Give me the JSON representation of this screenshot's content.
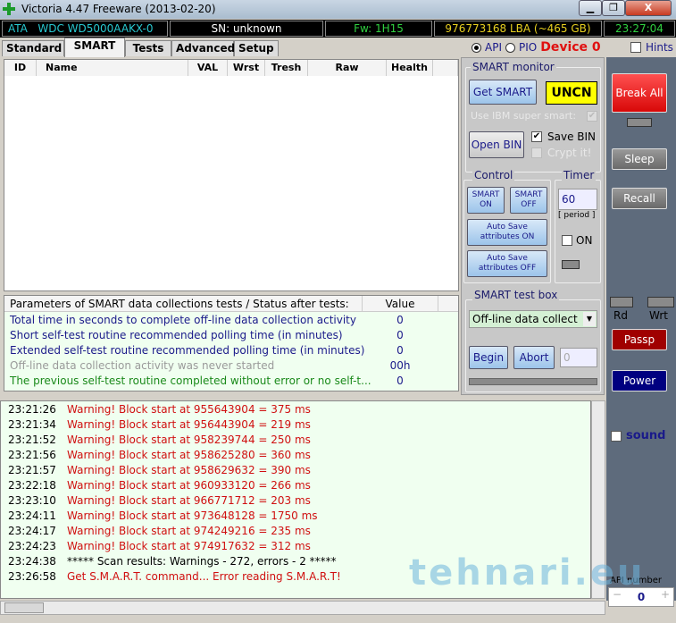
{
  "window": {
    "title": "Victoria 4.47  Freeware (2013-02-20)",
    "minimize": "▁",
    "maximize": "❐",
    "close": "X"
  },
  "infobar": {
    "interface": "ATA",
    "model": "WDC WD5000AAKX-0",
    "serial": "SN: unknown",
    "firmware": "Fw: 1H15",
    "capacity": "976773168 LBA (~465 GB)",
    "clock": "23:27:04"
  },
  "tabs": [
    "Standard",
    "SMART",
    "Tests",
    "Advanced",
    "Setup"
  ],
  "mode": {
    "api": "API",
    "pio": "PIO",
    "device": "Device 0",
    "hints": "Hints"
  },
  "smart_table": {
    "columns": [
      "ID",
      "Name",
      "VAL",
      "Wrst",
      "Tresh",
      "Raw",
      "Health"
    ]
  },
  "params": {
    "header": "Parameters of SMART data collections tests / Status after tests:",
    "value_header": "Value",
    "rows": [
      {
        "label": "Total time in seconds to complete off-line data collection activity",
        "value": "0",
        "color": "#1a1a8a"
      },
      {
        "label": "Short self-test routine recommended polling time (in minutes)",
        "value": "0",
        "color": "#1a1a8a"
      },
      {
        "label": "Extended self-test routine recommended polling time (in minutes)",
        "value": "0",
        "color": "#1a1a8a"
      },
      {
        "label": "Off-line data collection activity was never started",
        "value": "00h",
        "color": "#9a9a9a"
      },
      {
        "label": "The previous self-test routine completed without error or no self-t...",
        "value": "0",
        "color": "#1a8a1a"
      }
    ]
  },
  "monitor": {
    "title": "SMART monitor",
    "get_smart": "Get SMART",
    "status": "UNCN",
    "ibm": "Use IBM super smart:",
    "open_bin": "Open BIN",
    "save_bin": "Save BIN",
    "crypt": "Crypt it!"
  },
  "control": {
    "title": "Control",
    "smart_on": [
      "SMART",
      "ON"
    ],
    "smart_off": [
      "SMART",
      "OFF"
    ],
    "auto_on": [
      "Auto Save",
      "attributes ON"
    ],
    "auto_off": [
      "Auto Save",
      "attributes OFF"
    ]
  },
  "timer": {
    "title": "Timer",
    "value": "60",
    "period": "[ period ]",
    "on": "ON"
  },
  "testbox": {
    "title": "SMART test box",
    "selected": "Off-line data collect",
    "begin": "Begin",
    "abort": "Abort",
    "value": "0"
  },
  "side": {
    "break_all": "Break All",
    "sleep": "Sleep",
    "recall": "Recall",
    "rd": "Rd",
    "wrt": "Wrt",
    "passp": "Passp",
    "power": "Power",
    "sound": "sound",
    "api_number_label": "API number",
    "api_number": "0",
    "minus": "−",
    "plus": "+"
  },
  "log": [
    {
      "time": "23:21:26",
      "msg": "Warning! Block start at 955643904 = 375 ms",
      "color": "#d01010"
    },
    {
      "time": "23:21:34",
      "msg": "Warning! Block start at 956443904 = 219 ms",
      "color": "#d01010"
    },
    {
      "time": "23:21:52",
      "msg": "Warning! Block start at 958239744 = 250 ms",
      "color": "#d01010"
    },
    {
      "time": "23:21:56",
      "msg": "Warning! Block start at 958625280 = 360 ms",
      "color": "#d01010"
    },
    {
      "time": "23:21:57",
      "msg": "Warning! Block start at 958629632 = 390 ms",
      "color": "#d01010"
    },
    {
      "time": "23:22:18",
      "msg": "Warning! Block start at 960933120 = 266 ms",
      "color": "#d01010"
    },
    {
      "time": "23:23:10",
      "msg": "Warning! Block start at 966771712 = 203 ms",
      "color": "#d01010"
    },
    {
      "time": "23:24:11",
      "msg": "Warning! Block start at 973648128 = 1750 ms",
      "color": "#d01010"
    },
    {
      "time": "23:24:17",
      "msg": "Warning! Block start at 974249216 = 235 ms",
      "color": "#d01010"
    },
    {
      "time": "23:24:23",
      "msg": "Warning! Block start at 974917632 = 312 ms",
      "color": "#d01010"
    },
    {
      "time": "23:24:38",
      "msg": "***** Scan results: Warnings - 272, errors - 2 *****",
      "color": "#000000"
    },
    {
      "time": "23:26:58",
      "msg": "Get S.M.A.R.T. command... Error reading S.M.A.R.T!",
      "color": "#d01010"
    }
  ],
  "watermark": "tehnari.eu"
}
